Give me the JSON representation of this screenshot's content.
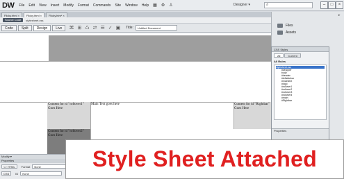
{
  "app": {
    "logo": "DW",
    "menus": [
      "File",
      "Edit",
      "View",
      "Insert",
      "Modify",
      "Format",
      "Commands",
      "Site",
      "Window",
      "Help"
    ],
    "menu_icons": [
      "▦",
      "⚙",
      "♙"
    ],
    "workspace": "Designer ▾",
    "search_icon": "search-icon",
    "window_buttons": [
      "–",
      "□",
      "×"
    ]
  },
  "tabs": [
    "Flicky.html ×",
    "Flicky.html ×",
    "Flicky.htm* ×"
  ],
  "source_bar": {
    "badge": "Source Code",
    "file": "stylesheet.css"
  },
  "doc_toolbar": {
    "views": [
      "Code",
      "Split",
      "Design",
      "Live"
    ],
    "active_view": "Design",
    "icons": [
      "⌘",
      "⊞",
      "♺",
      "⇄",
      "☰",
      "✓",
      "▣"
    ],
    "title_label": "Title:",
    "title_value": "Untitled Document"
  },
  "canvas": {
    "col_left_text": "Content for id \"rollover1\" Goes Here",
    "col_main_text": "Main Text goes here",
    "col_right_text": "Content for id \"Rightbar\" Goes Here",
    "col_bottom_text": "Content for id \"rollover2\" Goes Here"
  },
  "right_panel": {
    "items": [
      "Files",
      "Assets"
    ]
  },
  "css_panel": {
    "title": "CSS Styles",
    "tabs": [
      "All",
      "Current"
    ],
    "active_tab": "All",
    "section": "All Rules",
    "rules": [
      "stylesheet.css",
      "#wrapper",
      "body",
      "#header",
      "#leftsidebar",
      "#maintext",
      "#logo",
      "#rollover1",
      "#rollover2",
      "#rollover3",
      "#rollover4",
      "#main",
      "#Rightbar"
    ],
    "properties_label": "Properties"
  },
  "properties": {
    "title": "Modify ▾",
    "subtitle": "Properties",
    "row1_button": "<> HTML",
    "row1_label": "Format",
    "row1_value": "None",
    "row2_button": "CSS",
    "row2_label": "ID",
    "row2_value": "None"
  },
  "banner": {
    "text": "Style Sheet Attached",
    "color": "#e02020"
  }
}
